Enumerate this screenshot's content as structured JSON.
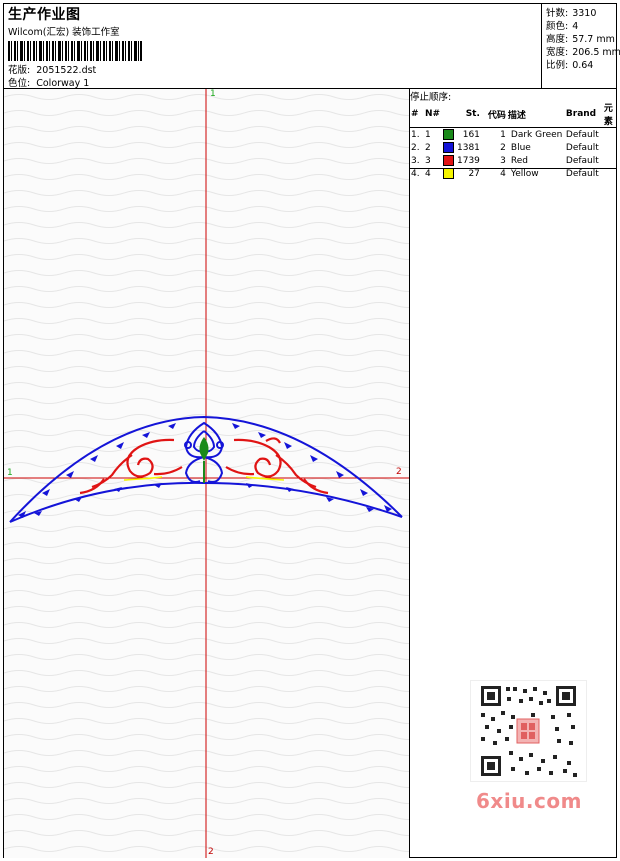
{
  "header": {
    "title": "生产作业图",
    "subtitle": "Wilcom(汇宏) 装饰工作室",
    "design_label": "花版:",
    "design_value": "2051522.dst",
    "colorway_label": "色位:",
    "colorway_value": "Colorway 1"
  },
  "stats": [
    {
      "label": "针数:",
      "value": "3310"
    },
    {
      "label": "颜色:",
      "value": "4"
    },
    {
      "label": "高度:",
      "value": "57.7 mm"
    },
    {
      "label": "宽度:",
      "value": "206.5 mm"
    },
    {
      "label": "比例:",
      "value": "0.64"
    }
  ],
  "axes": {
    "top": "1",
    "bottom": "2",
    "left": "1",
    "right": "2"
  },
  "stop_sequence": {
    "title": "停止顺序:",
    "columns": [
      "#",
      "N#",
      "St.",
      "代码",
      "描述",
      "Brand",
      "元素"
    ],
    "rows": [
      {
        "num": "1.",
        "n": "1",
        "color": "#1a8a1a",
        "st": "161",
        "code": "1",
        "desc": "Dark Green",
        "brand": "Default"
      },
      {
        "num": "2.",
        "n": "2",
        "color": "#1414d8",
        "st": "1381",
        "code": "2",
        "desc": "Blue",
        "brand": "Default"
      },
      {
        "num": "3.",
        "n": "3",
        "color": "#e01414",
        "st": "1739",
        "code": "3",
        "desc": "Red",
        "brand": "Default"
      },
      {
        "num": "4.",
        "n": "4",
        "color": "#f5f500",
        "st": "27",
        "code": "4",
        "desc": "Yellow",
        "brand": "Default"
      }
    ]
  },
  "watermark": {
    "text": "6xiu.com"
  },
  "colors": {
    "axis": "#cc0000",
    "thread_blue": "#1414d8",
    "thread_red": "#e01414",
    "thread_green": "#1a8a1a",
    "thread_yellow": "#f5f500"
  }
}
